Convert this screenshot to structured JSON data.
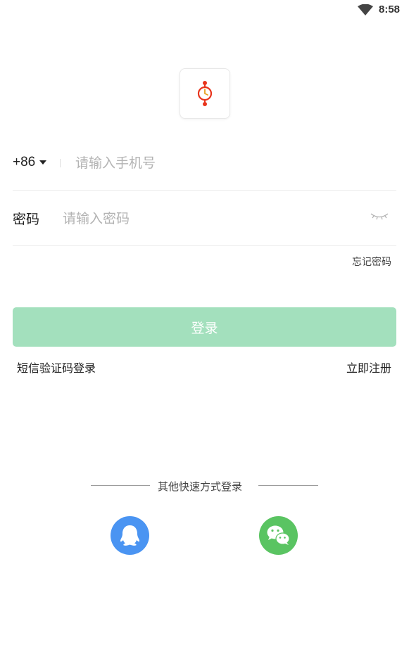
{
  "status_bar": {
    "time": "8:58",
    "wifi_icon": "wifi-icon"
  },
  "logo": {
    "icon": "app-logo-icon",
    "accent_color": "#e8341c"
  },
  "phone": {
    "country_code": "+86",
    "placeholder": "请输入手机号",
    "value": ""
  },
  "password": {
    "label": "密码",
    "placeholder": "请输入密码",
    "value": "",
    "toggle_icon": "eye-closed-icon"
  },
  "forgot_password": "忘记密码",
  "login_button": {
    "label": "登录",
    "color": "#a3e0bd"
  },
  "sms_login": "短信验证码登录",
  "register": "立即注册",
  "other_login": {
    "title": "其他快速方式登录",
    "options": [
      {
        "name": "qq-icon",
        "color": "#4a94f2"
      },
      {
        "name": "wechat-icon",
        "color": "#5ac462"
      }
    ]
  }
}
